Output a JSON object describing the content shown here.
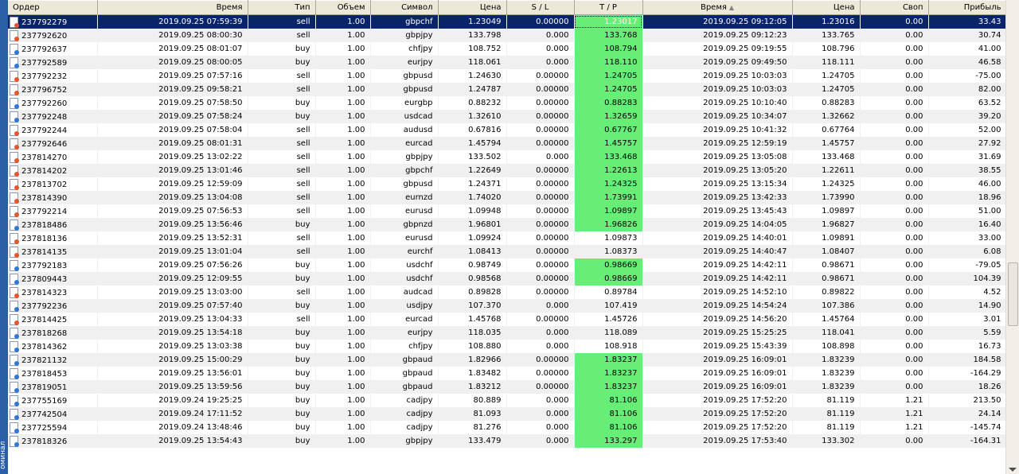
{
  "side_tab": {
    "label": "оминал"
  },
  "columns": [
    "Ордер",
    "Время",
    "Тип",
    "Объем",
    "Символ",
    "Цена",
    "S / L",
    "T / P",
    "Время",
    "Цена",
    "Своп",
    "Прибыль"
  ],
  "sorted_column_indicator": "▲",
  "colors": {
    "selected_row": "#0a246a",
    "tp_hit": "#66ee77",
    "sell_icon": "#e8552a",
    "buy_icon": "#2f78d9"
  },
  "rows": [
    {
      "order": "237792279",
      "open_time": "2019.09.25 07:59:39",
      "type": "sell",
      "volume": "1.00",
      "symbol": "gbpchf",
      "open_price": "1.23049",
      "sl": "0.00000",
      "tp": "1.23017",
      "tp_hit": true,
      "close_time": "2019.09.25 09:12:05",
      "close_price": "1.23016",
      "swap": "0.00",
      "profit": "33.43",
      "selected": true
    },
    {
      "order": "237792620",
      "open_time": "2019.09.25 08:00:30",
      "type": "sell",
      "volume": "1.00",
      "symbol": "gbpjpy",
      "open_price": "133.798",
      "sl": "0.000",
      "tp": "133.768",
      "tp_hit": true,
      "close_time": "2019.09.25 09:12:23",
      "close_price": "133.765",
      "swap": "0.00",
      "profit": "30.74"
    },
    {
      "order": "237792637",
      "open_time": "2019.09.25 08:01:07",
      "type": "buy",
      "volume": "1.00",
      "symbol": "chfjpy",
      "open_price": "108.752",
      "sl": "0.000",
      "tp": "108.794",
      "tp_hit": true,
      "close_time": "2019.09.25 09:19:55",
      "close_price": "108.796",
      "swap": "0.00",
      "profit": "41.00"
    },
    {
      "order": "237792589",
      "open_time": "2019.09.25 08:00:05",
      "type": "buy",
      "volume": "1.00",
      "symbol": "eurjpy",
      "open_price": "118.061",
      "sl": "0.000",
      "tp": "118.110",
      "tp_hit": true,
      "close_time": "2019.09.25 09:49:50",
      "close_price": "118.111",
      "swap": "0.00",
      "profit": "46.58"
    },
    {
      "order": "237792232",
      "open_time": "2019.09.25 07:57:16",
      "type": "sell",
      "volume": "1.00",
      "symbol": "gbpusd",
      "open_price": "1.24630",
      "sl": "0.00000",
      "tp": "1.24705",
      "tp_hit": true,
      "close_time": "2019.09.25 10:03:03",
      "close_price": "1.24705",
      "swap": "0.00",
      "profit": "-75.00"
    },
    {
      "order": "237796752",
      "open_time": "2019.09.25 09:58:21",
      "type": "sell",
      "volume": "1.00",
      "symbol": "gbpusd",
      "open_price": "1.24787",
      "sl": "0.00000",
      "tp": "1.24705",
      "tp_hit": true,
      "close_time": "2019.09.25 10:03:03",
      "close_price": "1.24705",
      "swap": "0.00",
      "profit": "82.00"
    },
    {
      "order": "237792260",
      "open_time": "2019.09.25 07:58:50",
      "type": "buy",
      "volume": "1.00",
      "symbol": "eurgbp",
      "open_price": "0.88232",
      "sl": "0.00000",
      "tp": "0.88283",
      "tp_hit": true,
      "close_time": "2019.09.25 10:10:40",
      "close_price": "0.88283",
      "swap": "0.00",
      "profit": "63.52"
    },
    {
      "order": "237792248",
      "open_time": "2019.09.25 07:58:24",
      "type": "buy",
      "volume": "1.00",
      "symbol": "usdcad",
      "open_price": "1.32610",
      "sl": "0.00000",
      "tp": "1.32659",
      "tp_hit": true,
      "close_time": "2019.09.25 10:34:07",
      "close_price": "1.32662",
      "swap": "0.00",
      "profit": "39.20"
    },
    {
      "order": "237792244",
      "open_time": "2019.09.25 07:58:04",
      "type": "sell",
      "volume": "1.00",
      "symbol": "audusd",
      "open_price": "0.67816",
      "sl": "0.00000",
      "tp": "0.67767",
      "tp_hit": true,
      "close_time": "2019.09.25 10:41:32",
      "close_price": "0.67764",
      "swap": "0.00",
      "profit": "52.00"
    },
    {
      "order": "237792646",
      "open_time": "2019.09.25 08:01:31",
      "type": "sell",
      "volume": "1.00",
      "symbol": "eurcad",
      "open_price": "1.45794",
      "sl": "0.00000",
      "tp": "1.45757",
      "tp_hit": true,
      "close_time": "2019.09.25 12:59:19",
      "close_price": "1.45757",
      "swap": "0.00",
      "profit": "27.92"
    },
    {
      "order": "237814270",
      "open_time": "2019.09.25 13:02:22",
      "type": "sell",
      "volume": "1.00",
      "symbol": "gbpjpy",
      "open_price": "133.502",
      "sl": "0.000",
      "tp": "133.468",
      "tp_hit": true,
      "close_time": "2019.09.25 13:05:08",
      "close_price": "133.468",
      "swap": "0.00",
      "profit": "31.69"
    },
    {
      "order": "237814202",
      "open_time": "2019.09.25 13:01:46",
      "type": "sell",
      "volume": "1.00",
      "symbol": "gbpchf",
      "open_price": "1.22649",
      "sl": "0.00000",
      "tp": "1.22613",
      "tp_hit": true,
      "close_time": "2019.09.25 13:05:20",
      "close_price": "1.22611",
      "swap": "0.00",
      "profit": "38.55"
    },
    {
      "order": "237813702",
      "open_time": "2019.09.25 12:59:09",
      "type": "sell",
      "volume": "1.00",
      "symbol": "gbpusd",
      "open_price": "1.24371",
      "sl": "0.00000",
      "tp": "1.24325",
      "tp_hit": true,
      "close_time": "2019.09.25 13:15:34",
      "close_price": "1.24325",
      "swap": "0.00",
      "profit": "46.00"
    },
    {
      "order": "237814390",
      "open_time": "2019.09.25 13:04:08",
      "type": "sell",
      "volume": "1.00",
      "symbol": "eurnzd",
      "open_price": "1.74020",
      "sl": "0.00000",
      "tp": "1.73991",
      "tp_hit": true,
      "close_time": "2019.09.25 13:42:33",
      "close_price": "1.73990",
      "swap": "0.00",
      "profit": "18.96"
    },
    {
      "order": "237792214",
      "open_time": "2019.09.25 07:56:53",
      "type": "sell",
      "volume": "1.00",
      "symbol": "eurusd",
      "open_price": "1.09948",
      "sl": "0.00000",
      "tp": "1.09897",
      "tp_hit": true,
      "close_time": "2019.09.25 13:45:43",
      "close_price": "1.09897",
      "swap": "0.00",
      "profit": "51.00"
    },
    {
      "order": "237818486",
      "open_time": "2019.09.25 13:56:46",
      "type": "buy",
      "volume": "1.00",
      "symbol": "gbpnzd",
      "open_price": "1.96801",
      "sl": "0.00000",
      "tp": "1.96826",
      "tp_hit": true,
      "close_time": "2019.09.25 14:04:05",
      "close_price": "1.96827",
      "swap": "0.00",
      "profit": "16.40"
    },
    {
      "order": "237818136",
      "open_time": "2019.09.25 13:52:31",
      "type": "sell",
      "volume": "1.00",
      "symbol": "eurusd",
      "open_price": "1.09924",
      "sl": "0.00000",
      "tp": "1.09873",
      "tp_hit": false,
      "close_time": "2019.09.25 14:40:01",
      "close_price": "1.09891",
      "swap": "0.00",
      "profit": "33.00"
    },
    {
      "order": "237814135",
      "open_time": "2019.09.25 13:01:04",
      "type": "sell",
      "volume": "1.00",
      "symbol": "eurchf",
      "open_price": "1.08413",
      "sl": "0.00000",
      "tp": "1.08373",
      "tp_hit": false,
      "close_time": "2019.09.25 14:40:47",
      "close_price": "1.08407",
      "swap": "0.00",
      "profit": "6.08"
    },
    {
      "order": "237792183",
      "open_time": "2019.09.25 07:56:26",
      "type": "buy",
      "volume": "1.00",
      "symbol": "usdchf",
      "open_price": "0.98749",
      "sl": "0.00000",
      "tp": "0.98669",
      "tp_hit": true,
      "close_time": "2019.09.25 14:42:11",
      "close_price": "0.98671",
      "swap": "0.00",
      "profit": "-79.05"
    },
    {
      "order": "237809443",
      "open_time": "2019.09.25 12:09:55",
      "type": "buy",
      "volume": "1.00",
      "symbol": "usdchf",
      "open_price": "0.98568",
      "sl": "0.00000",
      "tp": "0.98669",
      "tp_hit": true,
      "close_time": "2019.09.25 14:42:11",
      "close_price": "0.98671",
      "swap": "0.00",
      "profit": "104.39"
    },
    {
      "order": "237814323",
      "open_time": "2019.09.25 13:03:00",
      "type": "sell",
      "volume": "1.00",
      "symbol": "audcad",
      "open_price": "0.89828",
      "sl": "0.00000",
      "tp": "0.89784",
      "tp_hit": false,
      "close_time": "2019.09.25 14:52:10",
      "close_price": "0.89822",
      "swap": "0.00",
      "profit": "4.52"
    },
    {
      "order": "237792236",
      "open_time": "2019.09.25 07:57:40",
      "type": "buy",
      "volume": "1.00",
      "symbol": "usdjpy",
      "open_price": "107.370",
      "sl": "0.000",
      "tp": "107.419",
      "tp_hit": false,
      "close_time": "2019.09.25 14:54:24",
      "close_price": "107.386",
      "swap": "0.00",
      "profit": "14.90"
    },
    {
      "order": "237814425",
      "open_time": "2019.09.25 13:04:33",
      "type": "sell",
      "volume": "1.00",
      "symbol": "eurcad",
      "open_price": "1.45768",
      "sl": "0.00000",
      "tp": "1.45726",
      "tp_hit": false,
      "close_time": "2019.09.25 14:56:20",
      "close_price": "1.45764",
      "swap": "0.00",
      "profit": "3.01"
    },
    {
      "order": "237818268",
      "open_time": "2019.09.25 13:54:18",
      "type": "buy",
      "volume": "1.00",
      "symbol": "eurjpy",
      "open_price": "118.035",
      "sl": "0.000",
      "tp": "118.089",
      "tp_hit": false,
      "close_time": "2019.09.25 15:25:25",
      "close_price": "118.041",
      "swap": "0.00",
      "profit": "5.59"
    },
    {
      "order": "237814362",
      "open_time": "2019.09.25 13:03:38",
      "type": "buy",
      "volume": "1.00",
      "symbol": "chfjpy",
      "open_price": "108.880",
      "sl": "0.000",
      "tp": "108.918",
      "tp_hit": false,
      "close_time": "2019.09.25 15:43:39",
      "close_price": "108.898",
      "swap": "0.00",
      "profit": "16.73"
    },
    {
      "order": "237821132",
      "open_time": "2019.09.25 15:00:29",
      "type": "buy",
      "volume": "1.00",
      "symbol": "gbpaud",
      "open_price": "1.82966",
      "sl": "0.00000",
      "tp": "1.83237",
      "tp_hit": true,
      "close_time": "2019.09.25 16:09:01",
      "close_price": "1.83239",
      "swap": "0.00",
      "profit": "184.58"
    },
    {
      "order": "237818453",
      "open_time": "2019.09.25 13:56:01",
      "type": "buy",
      "volume": "1.00",
      "symbol": "gbpaud",
      "open_price": "1.83482",
      "sl": "0.00000",
      "tp": "1.83237",
      "tp_hit": true,
      "close_time": "2019.09.25 16:09:01",
      "close_price": "1.83239",
      "swap": "0.00",
      "profit": "-164.29"
    },
    {
      "order": "237819051",
      "open_time": "2019.09.25 13:59:56",
      "type": "buy",
      "volume": "1.00",
      "symbol": "gbpaud",
      "open_price": "1.83212",
      "sl": "0.00000",
      "tp": "1.83237",
      "tp_hit": true,
      "close_time": "2019.09.25 16:09:01",
      "close_price": "1.83239",
      "swap": "0.00",
      "profit": "18.26"
    },
    {
      "order": "237755169",
      "open_time": "2019.09.24 19:25:25",
      "type": "buy",
      "volume": "1.00",
      "symbol": "cadjpy",
      "open_price": "80.889",
      "sl": "0.000",
      "tp": "81.106",
      "tp_hit": true,
      "close_time": "2019.09.25 17:52:20",
      "close_price": "81.119",
      "swap": "1.21",
      "profit": "213.50"
    },
    {
      "order": "237742504",
      "open_time": "2019.09.24 17:11:52",
      "type": "buy",
      "volume": "1.00",
      "symbol": "cadjpy",
      "open_price": "81.093",
      "sl": "0.000",
      "tp": "81.106",
      "tp_hit": true,
      "close_time": "2019.09.25 17:52:20",
      "close_price": "81.119",
      "swap": "1.21",
      "profit": "24.14"
    },
    {
      "order": "237725594",
      "open_time": "2019.09.24 13:48:46",
      "type": "buy",
      "volume": "1.00",
      "symbol": "cadjpy",
      "open_price": "81.276",
      "sl": "0.000",
      "tp": "81.106",
      "tp_hit": true,
      "close_time": "2019.09.25 17:52:20",
      "close_price": "81.119",
      "swap": "1.21",
      "profit": "-145.74"
    },
    {
      "order": "237818326",
      "open_time": "2019.09.25 13:54:43",
      "type": "buy",
      "volume": "1.00",
      "symbol": "gbpjpy",
      "open_price": "133.479",
      "sl": "0.000",
      "tp": "133.297",
      "tp_hit": true,
      "close_time": "2019.09.25 17:53:40",
      "close_price": "133.302",
      "swap": "0.00",
      "profit": "-164.31"
    }
  ]
}
